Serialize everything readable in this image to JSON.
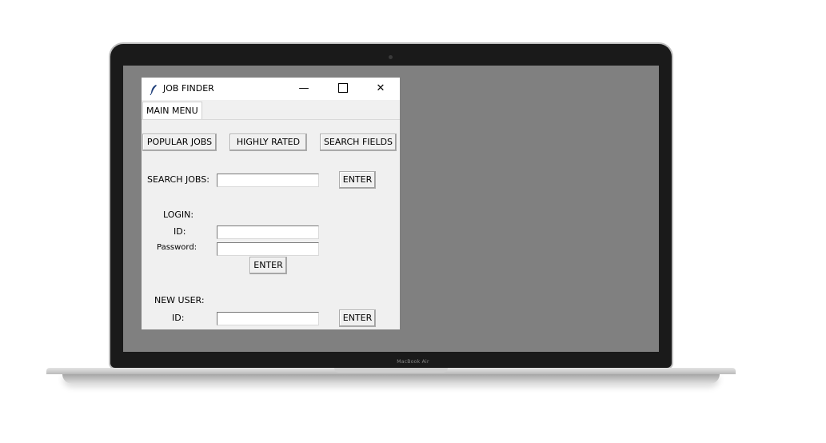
{
  "device": {
    "brand_label": "MacBook Air"
  },
  "window": {
    "title": "JOB FINDER",
    "icon": "feather-icon",
    "controls": {
      "minimize": "—",
      "close": "✕"
    }
  },
  "tabs": [
    {
      "label": "MAIN MENU",
      "selected": true
    }
  ],
  "main_menu": {
    "buttons": {
      "popular_jobs": "POPULAR JOBS",
      "highly_rated": "HIGHLY RATED",
      "search_fields": "SEARCH FIELDS"
    },
    "search": {
      "label": "SEARCH JOBS:",
      "value": "",
      "enter": "ENTER"
    },
    "login": {
      "heading": "LOGIN:",
      "id_label": "ID:",
      "id_value": "",
      "password_label": "Password:",
      "password_value": "",
      "enter": "ENTER"
    },
    "new_user": {
      "heading": "NEW USER:",
      "id_label": "ID:",
      "id_value": "",
      "enter": "ENTER"
    }
  },
  "colors": {
    "desktop": "#808080",
    "window_bg": "#f0f0f0",
    "titlebar_bg": "#ffffff"
  }
}
